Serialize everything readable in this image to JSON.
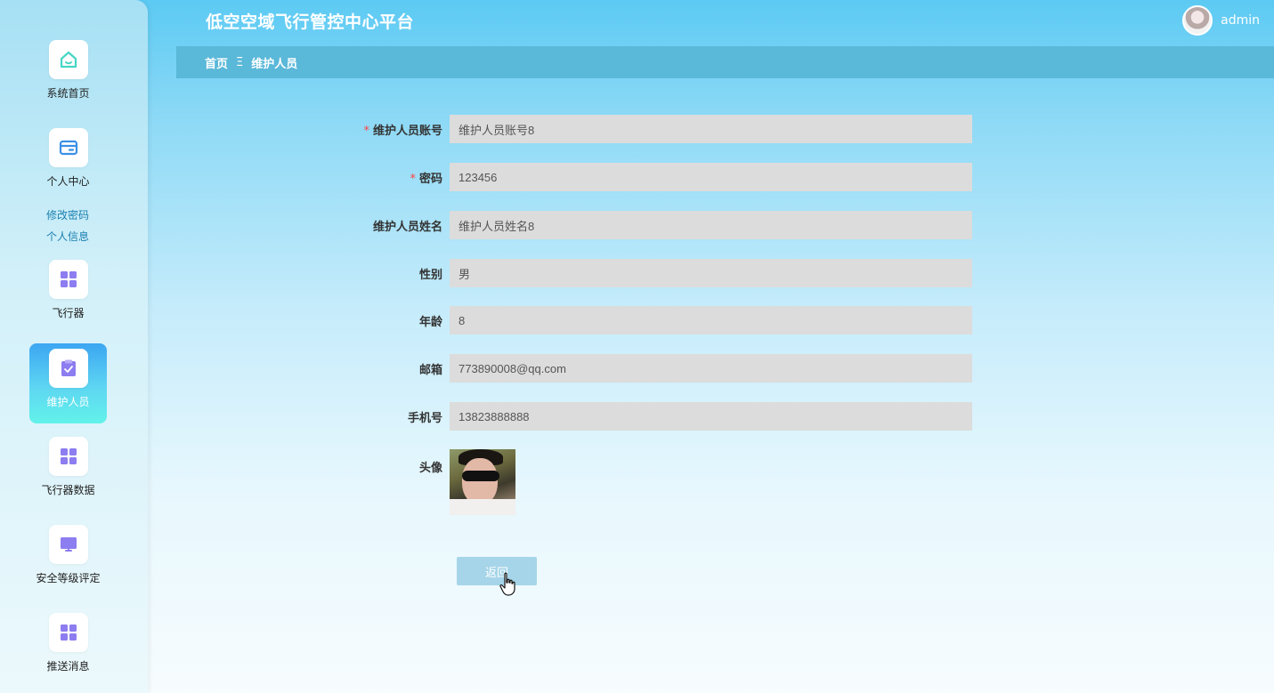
{
  "header": {
    "app_title": "低空空域飞行管控中心平台",
    "username": "admin"
  },
  "breadcrumb": {
    "home": "首页",
    "separator": "Ξ",
    "current": "维护人员"
  },
  "sidebar": {
    "items": [
      {
        "label": "系统首页",
        "icon": "home-icon"
      },
      {
        "label": "个人中心",
        "icon": "wallet-icon",
        "sub": [
          "修改密码",
          "个人信息"
        ]
      },
      {
        "label": "飞行器",
        "icon": "grid-icon"
      },
      {
        "label": "维护人员",
        "icon": "clipboard-check-icon",
        "active": true
      },
      {
        "label": "飞行器数据",
        "icon": "grid-icon"
      },
      {
        "label": "安全等级评定",
        "icon": "monitor-icon"
      },
      {
        "label": "推送消息",
        "icon": "grid-icon"
      }
    ]
  },
  "form": {
    "account": {
      "label": "维护人员账号",
      "value": "维护人员账号8",
      "required": true
    },
    "password": {
      "label": "密码",
      "value": "123456",
      "required": true
    },
    "name": {
      "label": "维护人员姓名",
      "value": "维护人员姓名8"
    },
    "gender": {
      "label": "性别",
      "value": "男"
    },
    "age": {
      "label": "年龄",
      "value": "8"
    },
    "email": {
      "label": "邮箱",
      "value": "773890008@qq.com"
    },
    "phone": {
      "label": "手机号",
      "value": "13823888888"
    },
    "avatar": {
      "label": "头像"
    },
    "required_mark": "*"
  },
  "actions": {
    "back_label": "返回"
  },
  "colors": {
    "accent": "#5ab8d9",
    "active_nav_top": "#3ca6f2",
    "active_nav_bottom": "#62f2ea",
    "icon_purple": "#8c7df0",
    "icon_teal": "#46d6c4",
    "icon_blue": "#3b8fe6",
    "required": "#ff4444"
  }
}
